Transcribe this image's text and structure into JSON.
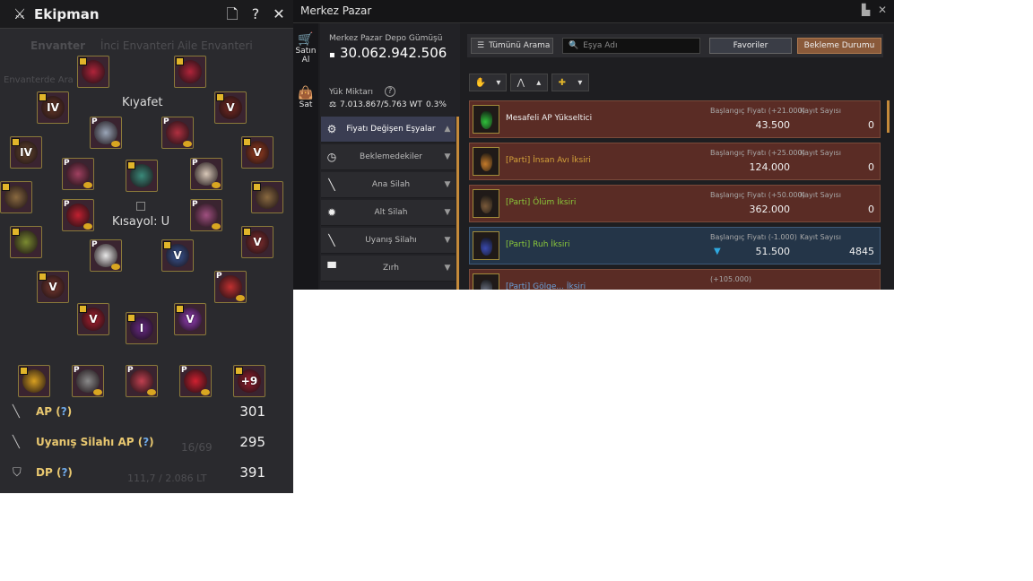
{
  "equipment": {
    "title": "Ekipman",
    "bg_tabs": [
      "Envanter",
      "İnci Envanteri",
      "Aile Envanteri"
    ],
    "bg_search": "Envanterde Ara",
    "bg_capacity": "16/69",
    "bg_weight": "111,7 / 2.086 LT",
    "section_costume": "Kıyafet",
    "section_shortcut": "Kısayol: U",
    "slots": [
      {
        "rank": "",
        "p": false,
        "color": "#b0243a"
      },
      {
        "rank": "",
        "p": false,
        "color": "#b0243a"
      },
      {
        "rank": "IV",
        "p": false,
        "color": "#6a3a28"
      },
      {
        "rank": "V",
        "p": false,
        "color": "#7a2a22"
      },
      {
        "rank": "",
        "p": true,
        "color": "#9aa6b8"
      },
      {
        "rank": "",
        "p": true,
        "color": "#b03040"
      },
      {
        "rank": "IV",
        "p": false,
        "color": "#6a4a30"
      },
      {
        "rank": "V",
        "p": false,
        "color": "#a04020"
      },
      {
        "rank": "",
        "p": true,
        "color": "#a04060"
      },
      {
        "rank": "",
        "p": false,
        "color": "#3a8a7a"
      },
      {
        "rank": "",
        "p": true,
        "color": "#d8c8b8"
      },
      {
        "rank": "",
        "p": false,
        "color": "#8a6a40"
      },
      {
        "rank": "",
        "p": false,
        "color": "#8a6a40"
      },
      {
        "rank": "",
        "p": true,
        "color": "#c02030"
      },
      {
        "rank": "",
        "p": true,
        "color": "#a05080"
      },
      {
        "rank": "",
        "p": false,
        "color": "#7a8a30"
      },
      {
        "rank": "V",
        "p": false,
        "color": "#8a3030"
      },
      {
        "rank": "V",
        "p": false,
        "color": "#7a3a30"
      },
      {
        "rank": "",
        "p": true,
        "color": "#c03030"
      },
      {
        "rank": "",
        "p": true,
        "color": "#e8e8e8"
      },
      {
        "rank": "V",
        "p": false,
        "color": "#3a5a9a"
      },
      {
        "rank": "V",
        "p": false,
        "color": "#b02030"
      },
      {
        "rank": "I",
        "p": false,
        "color": "#6a2a8a"
      },
      {
        "rank": "V",
        "p": false,
        "color": "#9a40c0"
      }
    ],
    "bottom_slots": [
      {
        "rank": "",
        "p": false,
        "color": "#d8a020"
      },
      {
        "rank": "",
        "p": true,
        "color": "#8a8a8a"
      },
      {
        "rank": "",
        "p": true,
        "color": "#c04050"
      },
      {
        "rank": "",
        "p": true,
        "color": "#d02030"
      },
      {
        "rank": "+9",
        "p": false,
        "color": "#a02030"
      }
    ],
    "stats": [
      {
        "name": "AP",
        "q": "?",
        "value": "301"
      },
      {
        "name": "Uyanış Silahı AP",
        "q": "?",
        "value": "295"
      },
      {
        "name": "DP",
        "q": "?",
        "value": "391"
      }
    ]
  },
  "market": {
    "title": "Merkez Pazar",
    "tab_buy": "Satın Al",
    "tab_sell": "Sat",
    "deposit_label": "Merkez Pazar Depo Gümüşü",
    "deposit_value": "30.062.942.506",
    "weight_label": "Yük Miktarı",
    "weight_value": "7.013.867/5.763 WT",
    "weight_pct": "0.3%",
    "categories": [
      {
        "label": "Fiyatı Değişen Eşyalar",
        "icon": "⚙",
        "active": true
      },
      {
        "label": "Beklemedekiler",
        "icon": "◷",
        "active": false
      },
      {
        "label": "Ana Silah",
        "icon": "╲",
        "active": false
      },
      {
        "label": "Alt Silah",
        "icon": "✹",
        "active": false
      },
      {
        "label": "Uyanış Silahı",
        "icon": "╲",
        "active": false
      },
      {
        "label": "Zırh",
        "icon": "▀",
        "active": false
      }
    ],
    "search_type": "Tümünü Arama",
    "search_placeholder": "Eşya Adı",
    "btn_fav": "Favoriler",
    "btn_wait": "Bekleme Durumu",
    "items": [
      {
        "name": "Mesafeli AP Yükseltici",
        "price_label": "Başlangıç Fiyatı (+21.000)",
        "count_label": "Kayıt Sayısı",
        "price": "43.500",
        "count": "0",
        "color": "#f0f0f0",
        "potion": "#2fbf3a",
        "hl": false
      },
      {
        "name": "[Parti] İnsan Avı İksiri",
        "price_label": "Başlangıç Fiyatı (+25.000)",
        "count_label": "Kayıt Sayısı",
        "price": "124.000",
        "count": "0",
        "color": "#d4a23a",
        "potion": "#c47a2a",
        "hl": false
      },
      {
        "name": "[Parti] Ölüm İksiri",
        "price_label": "Başlangıç Fiyatı (+50.000)",
        "count_label": "Kayıt Sayısı",
        "price": "362.000",
        "count": "0",
        "color": "#8ac83a",
        "potion": "#7a5a3a",
        "hl": false
      },
      {
        "name": "[Parti] Ruh İksiri",
        "price_label": "Başlangıç Fiyatı (-1.000)",
        "count_label": "Kayıt Sayısı",
        "price": "51.500",
        "count": "4845",
        "color": "#8ac83a",
        "potion": "#3a4ab0",
        "hl": true
      },
      {
        "name": "[Parti] Gölge... İksiri",
        "price_label": "(+105.000)",
        "count_label": "",
        "price": "",
        "count": "",
        "color": "#6aa0d8",
        "potion": "#6a7080",
        "hl": false
      }
    ]
  },
  "colors": {
    "accent": "#c48a3a",
    "gold_text": "#e9c870",
    "item_row": "#5a2c25",
    "item_row_hl": "#243548"
  }
}
